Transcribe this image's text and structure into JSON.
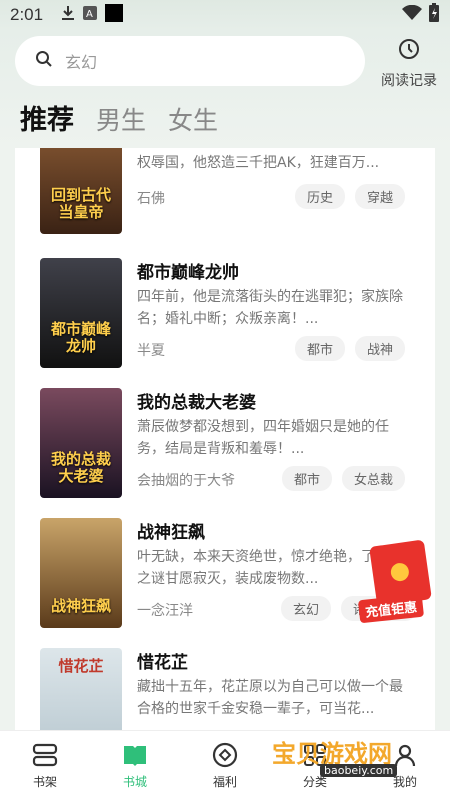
{
  "status_bar": {
    "time": "2:01"
  },
  "search": {
    "placeholder": "玄幻"
  },
  "history": {
    "label": "阅读记录"
  },
  "tabs": [
    {
      "label": "推荐",
      "active": true
    },
    {
      "label": "男生",
      "active": false
    },
    {
      "label": "女生",
      "active": false
    }
  ],
  "books": [
    {
      "title": "",
      "cover_text": "回到古代当皇帝",
      "cover_color": "#4a2e1c",
      "desc": "热血青年穿越古代为皇，面对送女和亲，丧权辱国，他怒造三千把AK，狂建百万...",
      "author": "石佛",
      "tags": [
        "历史",
        "穿越"
      ]
    },
    {
      "title": "都市巅峰龙帅",
      "cover_text": "都市巅峰龙帅",
      "cover_color": "#1e1e24",
      "desc": "四年前，他是流落街头的在逃罪犯；家族除名；婚礼中断；众叛亲离！...",
      "author": "半夏",
      "tags": [
        "都市",
        "战神"
      ]
    },
    {
      "title": "我的总裁大老婆",
      "cover_text": "我的总裁大老婆",
      "cover_color": "#3b2532",
      "desc": "萧辰做梦都没想到，四年婚姻只是她的任务，结局是背叛和羞辱！...",
      "author": "会抽烟的于大爷",
      "tags": [
        "都市",
        "女总裁"
      ]
    },
    {
      "title": "战神狂飙",
      "cover_text": "战神狂飙",
      "cover_color": "#6b4f2a",
      "desc": "叶无缺，本来天资绝世，惊才绝艳，了身世之谜甘愿寂灭，装成废物数...",
      "author": "一念汪洋",
      "tags": [
        "玄幻",
        "诸天万界"
      ]
    },
    {
      "title": "惜花芷",
      "cover_text": "惜花芷",
      "cover_color": "#c9d6dc",
      "desc": "藏拙十五年，花芷原以为自己可以做一个最合格的世家千金安稳一辈子，可当花...",
      "author": "",
      "tags": []
    }
  ],
  "promo": {
    "label": "充值钜惠"
  },
  "bottom_nav": [
    {
      "label": "书架",
      "icon": "shelf-icon",
      "active": false
    },
    {
      "label": "书城",
      "icon": "book-icon",
      "active": true
    },
    {
      "label": "福利",
      "icon": "gift-icon",
      "active": false
    },
    {
      "label": "分类",
      "icon": "category-icon",
      "active": false
    },
    {
      "label": "我的",
      "icon": "user-icon",
      "active": false
    }
  ],
  "watermark": {
    "text": "宝贝游戏网",
    "sub": "baobeiy.com"
  },
  "colors": {
    "accent": "#2fbf7a",
    "background": "#eef3ef"
  }
}
